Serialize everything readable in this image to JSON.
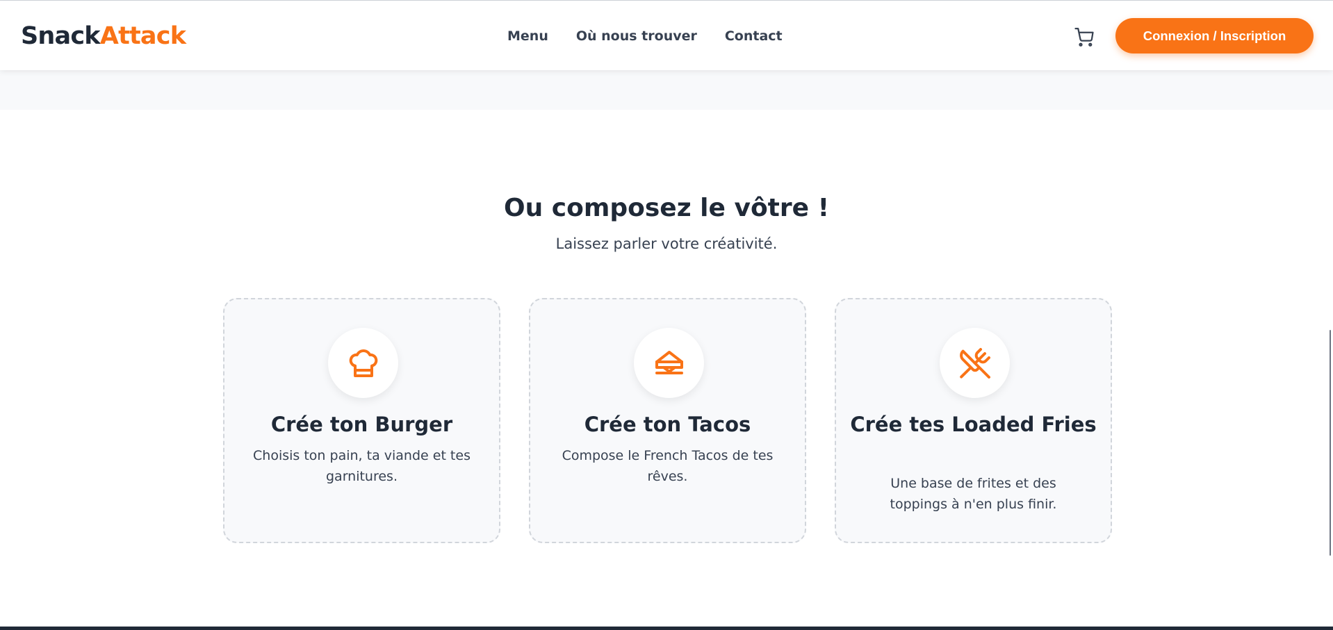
{
  "header": {
    "logo_part1": "Snack",
    "logo_part2": "Attack",
    "nav": [
      "Menu",
      "Où nous trouver",
      "Contact"
    ],
    "cart_icon": "shopping-cart-icon",
    "login_label": "Connexion / Inscription"
  },
  "section": {
    "title": "Ou composez le vôtre !",
    "subtitle": "Laissez parler votre créativité."
  },
  "cards": [
    {
      "icon": "chef-hat-icon",
      "title": "Crée ton Burger",
      "description": "Choisis ton pain, ta viande et tes garnitures."
    },
    {
      "icon": "sandwich-icon",
      "title": "Crée ton Tacos",
      "description": "Compose le French Tacos de tes rêves."
    },
    {
      "icon": "utensils-crossed-icon",
      "title": "Crée tes Loaded Fries",
      "description": "Une base de frites et des toppings à n'en plus finir."
    }
  ],
  "colors": {
    "accent": "#f97316",
    "dark": "#1f2937",
    "card_bg": "#f8f9fb",
    "card_border": "#d1d5db"
  }
}
